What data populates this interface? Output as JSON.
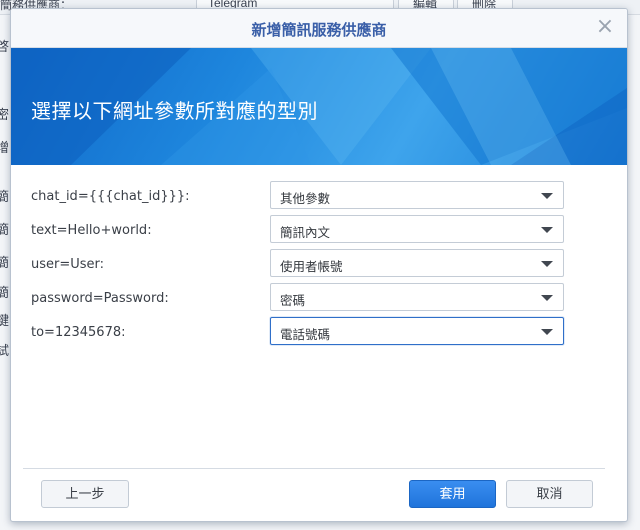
{
  "background": {
    "top_label": "簡務供應商：",
    "top_value": "Telegram",
    "top_button_1": "編輯",
    "top_button_2": "刪除",
    "side_fragments": [
      "啓",
      "密",
      "增",
      "簡",
      "簡",
      "簡",
      "簡",
      "鍵",
      "試"
    ]
  },
  "dialog": {
    "title": "新增簡訊服務供應商",
    "banner_heading": "選擇以下網址參數所對應的型別",
    "rows": [
      {
        "label": "chat_id={{{chat_id}}}:",
        "value": "其他參數"
      },
      {
        "label": "text=Hello+world:",
        "value": "簡訊內文"
      },
      {
        "label": "user=User:",
        "value": "使用者帳號"
      },
      {
        "label": "password=Password:",
        "value": "密碼"
      },
      {
        "label": "to=12345678:",
        "value": "電話號碼"
      }
    ],
    "buttons": {
      "prev": "上一步",
      "apply": "套用",
      "cancel": "取消"
    },
    "close_glyph": "×"
  },
  "colors": {
    "accent": "#1f74db",
    "banner": "#1e86dd",
    "title": "#3a5fa8"
  }
}
